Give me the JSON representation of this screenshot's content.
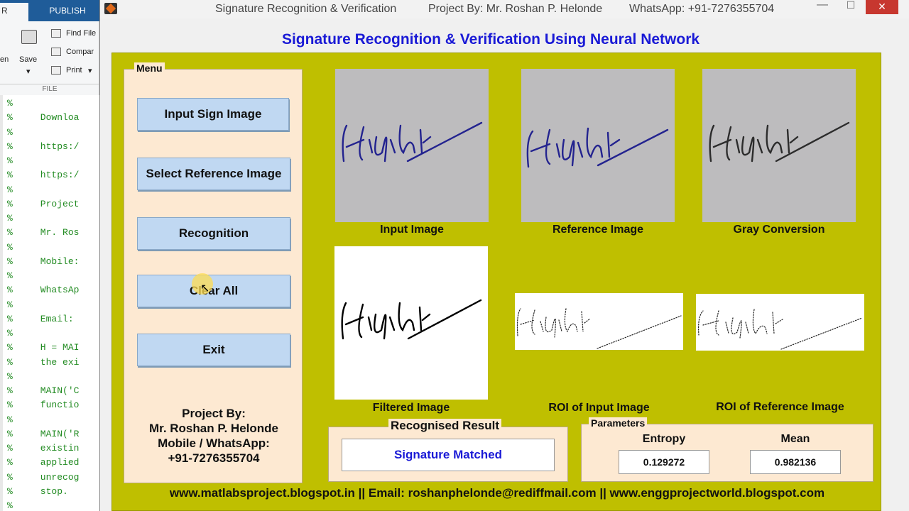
{
  "background": {
    "tabs": {
      "left_fragment": "R",
      "publish": "PUBLISH"
    },
    "ribbon": {
      "open_label": "en",
      "save_label": "Save",
      "find_files_label": "Find File",
      "compare_label": "Compar",
      "print_label": "Print",
      "file_section": "FILE"
    },
    "code_lines": [
      "%",
      "%     Downloa",
      "%",
      "%     https:/",
      "%",
      "%     https:/",
      "%",
      "%     Project",
      "%",
      "%     Mr. Ros",
      "%",
      "%     Mobile:",
      "%",
      "%     WhatsAp",
      "%",
      "%     Email: ",
      "%",
      "%     H = MAI",
      "%     the exi",
      "%",
      "%     MAIN('C",
      "%     functio",
      "%",
      "%     MAIN('R",
      "%     existin",
      "%     applied",
      "%     unrecog",
      "%     stop.",
      "%"
    ]
  },
  "window": {
    "title_app": "Signature Recognition & Verification",
    "title_project": "Project By: Mr. Roshan P. Helonde",
    "title_whatsapp": "WhatsApp: +91-7276355704",
    "minimize": "—",
    "maximize": "☐",
    "close": "✕"
  },
  "heading": "Signature Recognition & Verification Using Neural Network",
  "menu": {
    "legend": "Menu",
    "buttons": [
      "Input Sign Image",
      "Select Reference Image",
      "Recognition",
      "Clear All",
      "Exit"
    ],
    "credits": [
      "Project By:",
      "Mr. Roshan P. Helonde",
      "Mobile / WhatsApp:",
      "+91-7276355704"
    ]
  },
  "images": {
    "input": "Input Image",
    "reference": "Reference Image",
    "gray": "Gray Conversion",
    "filtered": "Filtered Image",
    "roi_input": "ROI of Input Image",
    "roi_reference": "ROI of Reference Image"
  },
  "result": {
    "legend": "Recognised Result",
    "value": "Signature Matched"
  },
  "parameters": {
    "legend": "Parameters",
    "entropy_label": "Entropy",
    "entropy_value": "0.129272",
    "mean_label": "Mean",
    "mean_value": "0.982136"
  },
  "footer": "www.matlabsproject.blogspot.in  ||  Email: roshanphelonde@rediffmail.com  ||  www.enggprojectworld.blogspot.com",
  "colors": {
    "panel_bg": "#bfbf00",
    "menu_bg": "#fde9d2",
    "button_bg": "#c0d8f2",
    "heading_color": "#1a1ad6",
    "ink_blue": "#23238f"
  }
}
